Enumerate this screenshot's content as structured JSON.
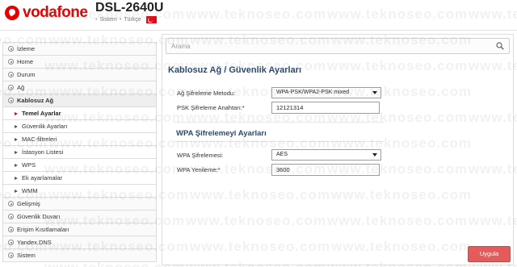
{
  "header": {
    "brand": "vodafone",
    "model": "DSL-2640U",
    "breadcrumb": [
      "Sistem",
      "Türkçe"
    ]
  },
  "sidebar": {
    "items": [
      {
        "label": "İzleme",
        "level": 0
      },
      {
        "label": "Home",
        "level": 0
      },
      {
        "label": "Durum",
        "level": 0
      },
      {
        "label": "Ağ",
        "level": 0
      },
      {
        "label": "Kablosuz Ağ",
        "level": 0,
        "expanded": true
      },
      {
        "label": "Temel Ayarlar",
        "level": 1,
        "active": true
      },
      {
        "label": "Güvenlik Ayarları",
        "level": 1
      },
      {
        "label": "MAC-filtreleri",
        "level": 1
      },
      {
        "label": "İstasyon Listesi",
        "level": 1
      },
      {
        "label": "WPS",
        "level": 1
      },
      {
        "label": "Ek ayarlamalar",
        "level": 1
      },
      {
        "label": "WMM",
        "level": 1
      },
      {
        "label": "Gelişmiş",
        "level": 0
      },
      {
        "label": "Güvenlik Duvarı",
        "level": 0
      },
      {
        "label": "Erişim Kısıtlamaları",
        "level": 0
      },
      {
        "label": "Yandex.DNS",
        "level": 0
      },
      {
        "label": "Sistem",
        "level": 0
      }
    ]
  },
  "search": {
    "placeholder": "Arama"
  },
  "main": {
    "title": "Kablosuz Ağ /  Güvenlik Ayarları",
    "encryption_label": "Ağ Şifreleme Metodu:",
    "encryption_value": "WPA-PSK/WPA2-PSK mixed",
    "psk_label": "PSK Şifreleme Anahtarı:*",
    "psk_value": "12121314",
    "wpa_section_title": "WPA Şifrelemeyi Ayarları",
    "wpa_cipher_label": "WPA Şifrelemesi:",
    "wpa_cipher_value": "AES",
    "wpa_renew_label": "WPA Yenileme:*",
    "wpa_renew_value": "3600",
    "apply_label": "Uygula"
  },
  "watermark": "www.teknoseo.com",
  "colors": {
    "brand": "#e60000",
    "heading": "#2b4a6e",
    "apply_button": "#e55a5a"
  }
}
